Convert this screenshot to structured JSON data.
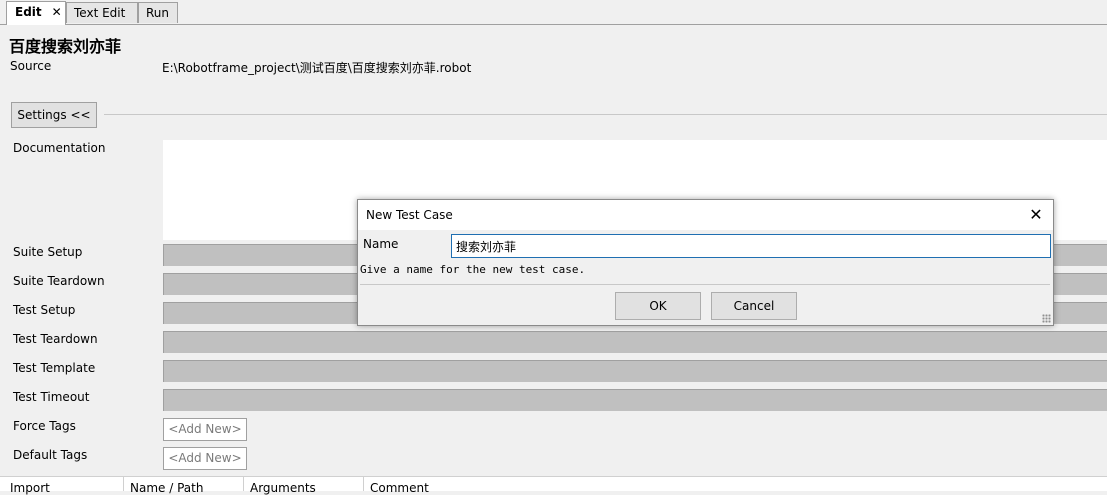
{
  "tabs": [
    {
      "label": "Edit",
      "close": "✕"
    },
    {
      "label": "Text Edit"
    },
    {
      "label": "Run"
    }
  ],
  "suite": {
    "title": "百度搜索刘亦菲",
    "source_label": "Source",
    "source_value": "E:\\Robotframe_project\\测试百度\\百度搜索刘亦菲.robot"
  },
  "settings": {
    "toggle_label": "Settings <<",
    "documentation_label": "Documentation",
    "rows": [
      {
        "label": "Suite Setup"
      },
      {
        "label": "Suite Teardown"
      },
      {
        "label": "Test Setup"
      },
      {
        "label": "Test Teardown"
      },
      {
        "label": "Test Template"
      },
      {
        "label": "Test Timeout"
      }
    ],
    "force_tags_label": "Force Tags",
    "default_tags_label": "Default Tags",
    "add_new_label": "<Add New>"
  },
  "import_table": {
    "columns": [
      "Import",
      "Name / Path",
      "Arguments",
      "Comment"
    ]
  },
  "dialog": {
    "title": "New Test Case",
    "close_glyph": "✕",
    "name_label": "Name",
    "name_value": "搜索刘亦菲",
    "help_text": "Give a name for the new test case.",
    "ok_label": "OK",
    "cancel_label": "Cancel"
  }
}
